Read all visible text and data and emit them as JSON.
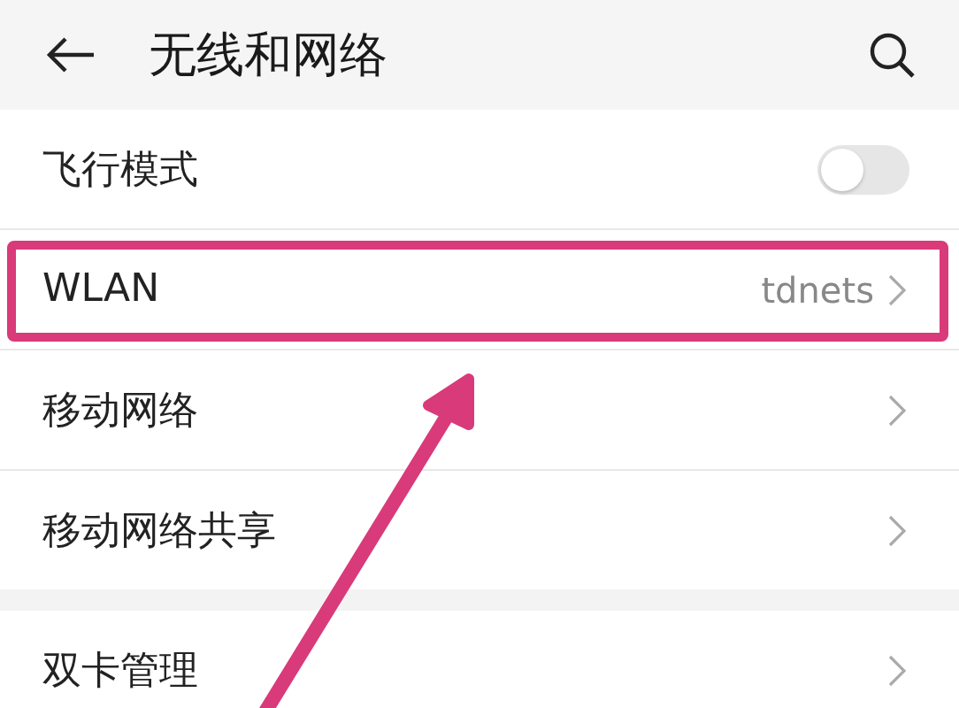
{
  "header": {
    "title": "无线和网络"
  },
  "sections": [
    {
      "items": [
        {
          "kind": "toggle",
          "label": "飞行模式",
          "on": false,
          "highlighted": false
        },
        {
          "kind": "link",
          "label": "WLAN",
          "value": "tdnets",
          "highlighted": true
        },
        {
          "kind": "link",
          "label": "移动网络",
          "highlighted": false
        },
        {
          "kind": "link",
          "label": "移动网络共享",
          "highlighted": false
        }
      ]
    },
    {
      "items": [
        {
          "kind": "link",
          "label": "双卡管理",
          "highlighted": false
        }
      ]
    }
  ]
}
